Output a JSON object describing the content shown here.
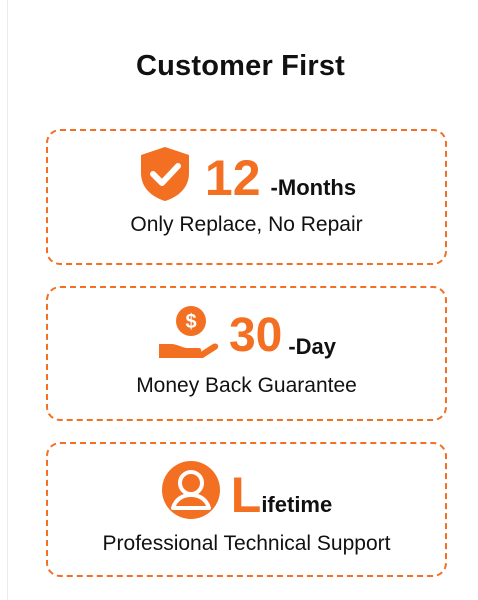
{
  "title": "Customer First",
  "colors": {
    "accent": "#f36f21",
    "text": "#111111",
    "background": "#ffffff"
  },
  "cards": [
    {
      "icon": "shield-check-icon",
      "highlight": "12",
      "suffix": "-Months",
      "description": "Only Replace, No Repair"
    },
    {
      "icon": "money-hand-icon",
      "highlight": "30",
      "suffix": "-Day",
      "description": "Money Back Guarantee"
    },
    {
      "icon": "user-circle-icon",
      "highlight": "L",
      "suffix": "ifetime",
      "description": "Professional Technical Support"
    }
  ]
}
